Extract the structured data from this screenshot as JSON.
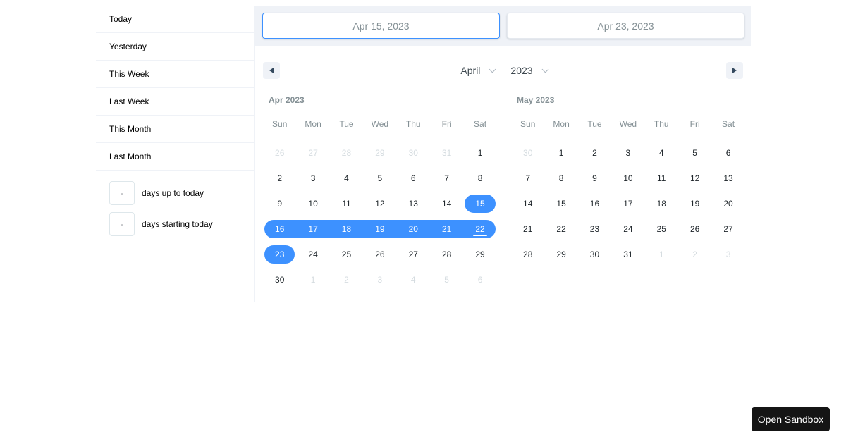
{
  "sidebar": {
    "static_ranges": [
      {
        "label": "Today"
      },
      {
        "label": "Yesterday"
      },
      {
        "label": "This Week"
      },
      {
        "label": "Last Week"
      },
      {
        "label": "This Month"
      },
      {
        "label": "Last Month"
      }
    ],
    "input_ranges": [
      {
        "value": "-",
        "label": "days up to today"
      },
      {
        "value": "-",
        "label": "days starting today"
      }
    ]
  },
  "date_display": {
    "start": "Apr 15, 2023",
    "end": "Apr 23, 2023"
  },
  "navigation": {
    "month_select": "April",
    "year_select": "2023",
    "prev_icon": "caret-left-icon",
    "next_icon": "caret-right-icon"
  },
  "colors": {
    "accent": "#3d91ff",
    "passive_day": "#d5dce0",
    "muted_text": "#849095"
  },
  "calendars": [
    {
      "name": "Apr 2023",
      "weekdays": [
        "Sun",
        "Mon",
        "Tue",
        "Wed",
        "Thu",
        "Fri",
        "Sat"
      ],
      "days": [
        {
          "d": "26",
          "s": "passive"
        },
        {
          "d": "27",
          "s": "passive"
        },
        {
          "d": "28",
          "s": "passive"
        },
        {
          "d": "29",
          "s": "passive"
        },
        {
          "d": "30",
          "s": "passive"
        },
        {
          "d": "31",
          "s": "passive"
        },
        {
          "d": "1",
          "s": ""
        },
        {
          "d": "2",
          "s": ""
        },
        {
          "d": "3",
          "s": ""
        },
        {
          "d": "4",
          "s": ""
        },
        {
          "d": "5",
          "s": ""
        },
        {
          "d": "6",
          "s": ""
        },
        {
          "d": "7",
          "s": ""
        },
        {
          "d": "8",
          "s": ""
        },
        {
          "d": "9",
          "s": ""
        },
        {
          "d": "10",
          "s": ""
        },
        {
          "d": "11",
          "s": ""
        },
        {
          "d": "12",
          "s": ""
        },
        {
          "d": "13",
          "s": ""
        },
        {
          "d": "14",
          "s": ""
        },
        {
          "d": "15",
          "s": "start"
        },
        {
          "d": "16",
          "s": "in-range"
        },
        {
          "d": "17",
          "s": "in-range"
        },
        {
          "d": "18",
          "s": "in-range"
        },
        {
          "d": "19",
          "s": "in-range"
        },
        {
          "d": "20",
          "s": "in-range"
        },
        {
          "d": "21",
          "s": "in-range"
        },
        {
          "d": "22",
          "s": "in-range today"
        },
        {
          "d": "23",
          "s": "end"
        },
        {
          "d": "24",
          "s": ""
        },
        {
          "d": "25",
          "s": ""
        },
        {
          "d": "26",
          "s": ""
        },
        {
          "d": "27",
          "s": ""
        },
        {
          "d": "28",
          "s": ""
        },
        {
          "d": "29",
          "s": ""
        },
        {
          "d": "30",
          "s": ""
        },
        {
          "d": "1",
          "s": "passive"
        },
        {
          "d": "2",
          "s": "passive"
        },
        {
          "d": "3",
          "s": "passive"
        },
        {
          "d": "4",
          "s": "passive"
        },
        {
          "d": "5",
          "s": "passive"
        },
        {
          "d": "6",
          "s": "passive"
        }
      ]
    },
    {
      "name": "May 2023",
      "weekdays": [
        "Sun",
        "Mon",
        "Tue",
        "Wed",
        "Thu",
        "Fri",
        "Sat"
      ],
      "days": [
        {
          "d": "30",
          "s": "passive"
        },
        {
          "d": "1",
          "s": ""
        },
        {
          "d": "2",
          "s": ""
        },
        {
          "d": "3",
          "s": ""
        },
        {
          "d": "4",
          "s": ""
        },
        {
          "d": "5",
          "s": ""
        },
        {
          "d": "6",
          "s": ""
        },
        {
          "d": "7",
          "s": ""
        },
        {
          "d": "8",
          "s": ""
        },
        {
          "d": "9",
          "s": ""
        },
        {
          "d": "10",
          "s": ""
        },
        {
          "d": "11",
          "s": ""
        },
        {
          "d": "12",
          "s": ""
        },
        {
          "d": "13",
          "s": ""
        },
        {
          "d": "14",
          "s": ""
        },
        {
          "d": "15",
          "s": ""
        },
        {
          "d": "16",
          "s": ""
        },
        {
          "d": "17",
          "s": ""
        },
        {
          "d": "18",
          "s": ""
        },
        {
          "d": "19",
          "s": ""
        },
        {
          "d": "20",
          "s": ""
        },
        {
          "d": "21",
          "s": ""
        },
        {
          "d": "22",
          "s": ""
        },
        {
          "d": "23",
          "s": ""
        },
        {
          "d": "24",
          "s": ""
        },
        {
          "d": "25",
          "s": ""
        },
        {
          "d": "26",
          "s": ""
        },
        {
          "d": "27",
          "s": ""
        },
        {
          "d": "28",
          "s": ""
        },
        {
          "d": "29",
          "s": ""
        },
        {
          "d": "30",
          "s": ""
        },
        {
          "d": "31",
          "s": ""
        },
        {
          "d": "1",
          "s": "passive"
        },
        {
          "d": "2",
          "s": "passive"
        },
        {
          "d": "3",
          "s": "passive"
        }
      ]
    }
  ],
  "footer": {
    "sandbox_label": "Open Sandbox"
  }
}
